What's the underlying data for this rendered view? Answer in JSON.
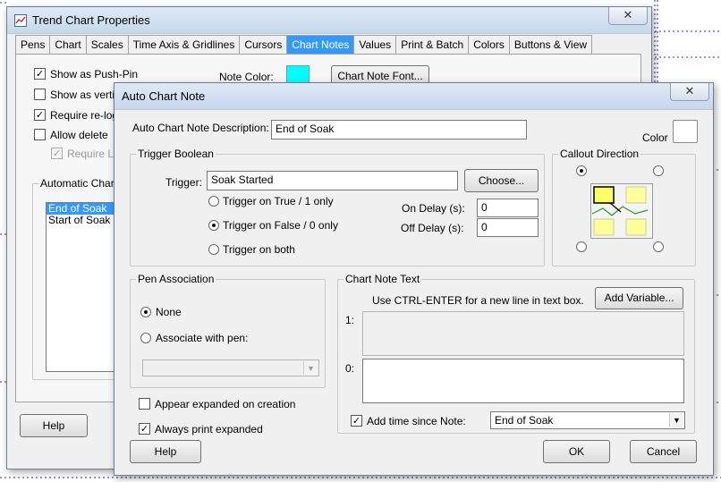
{
  "trend_window": {
    "title": "Trend Chart Properties",
    "tabs": [
      "Pens",
      "Chart",
      "Scales",
      "Time Axis & Gridlines",
      "Cursors",
      "Chart Notes",
      "Values",
      "Print & Batch",
      "Colors",
      "Buttons & View"
    ],
    "active_tab": "Chart Notes",
    "options": {
      "show_push_pin": "Show as Push-Pin",
      "show_vertical": "Show as vertic",
      "require_relogin": "Require re-login",
      "allow_delete": "Allow delete",
      "require_le": "Require Le"
    },
    "note_color_label": "Note Color:",
    "note_color": "#00ffff",
    "chart_note_font_button": "Chart Note Font...",
    "automatic_group_title": "Automatic Chart N",
    "auto_notes": [
      "End of Soak",
      "Start of Soak"
    ],
    "help_button": "Help"
  },
  "auto_dialog": {
    "title": "Auto Chart Note",
    "description_label": "Auto Chart Note Description:",
    "description_value": "End of Soak",
    "color_label": "Color",
    "trigger_group": "Trigger Boolean",
    "trigger_label": "Trigger:",
    "trigger_value": "Soak Started",
    "choose_button": "Choose...",
    "trigger_true": "Trigger on True / 1  only",
    "trigger_false": "Trigger on False / 0 only",
    "trigger_both": "Trigger on both",
    "on_delay_label": "On Delay (s):",
    "on_delay_value": "0",
    "off_delay_label": "Off Delay (s):",
    "off_delay_value": "0",
    "callout_group": "Callout Direction",
    "pen_group": "Pen Association",
    "pen_none": "None",
    "pen_associate": "Associate with pen:",
    "appear_expanded": "Appear expanded on creation",
    "always_print": "Always print expanded",
    "text_group": "Chart Note Text",
    "hint": "Use CTRL-ENTER for a new line in text box.",
    "add_variable_button": "Add Variable...",
    "line1_label": "1:",
    "line0_label": "0:",
    "add_time_label": "Add time since Note:",
    "add_time_value": "End of Soak",
    "help_button": "Help",
    "ok_button": "OK",
    "cancel_button": "Cancel",
    "close_symbol": "✕"
  }
}
